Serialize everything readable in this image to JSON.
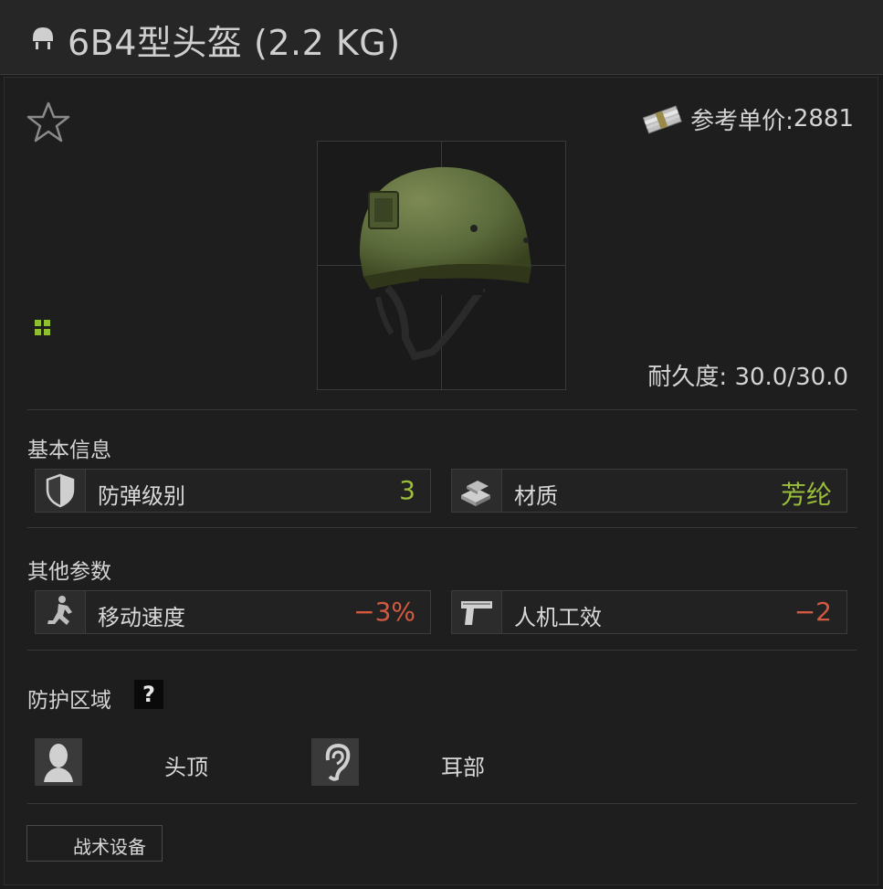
{
  "title": "6B4型头盔 (2.2 KG)",
  "price": {
    "label": "参考单价:",
    "value": "2881"
  },
  "durability": "耐久度: 30.0/30.0",
  "sections": {
    "basic": {
      "title": "基本信息",
      "stats": [
        {
          "icon": "shield-icon",
          "name": "防弹级别",
          "value": "3",
          "color": "#9abd3a"
        },
        {
          "icon": "material-icon",
          "name": "材质",
          "value": "芳纶",
          "color": "#9abd3a"
        }
      ]
    },
    "other": {
      "title": "其他参数",
      "stats": [
        {
          "icon": "running-soldier-icon",
          "name": "移动速度",
          "value": "−3%",
          "color": "#d35a41"
        },
        {
          "icon": "pistol-icon",
          "name": "人机工效",
          "value": "−2",
          "color": "#d35a41"
        }
      ]
    },
    "protection": {
      "title": "防护区域",
      "help": "?",
      "zones": [
        {
          "icon": "head-icon",
          "label": "头顶"
        },
        {
          "icon": "ear-icon",
          "label": "耳部"
        }
      ]
    }
  },
  "tactical_tab": "战术设备"
}
